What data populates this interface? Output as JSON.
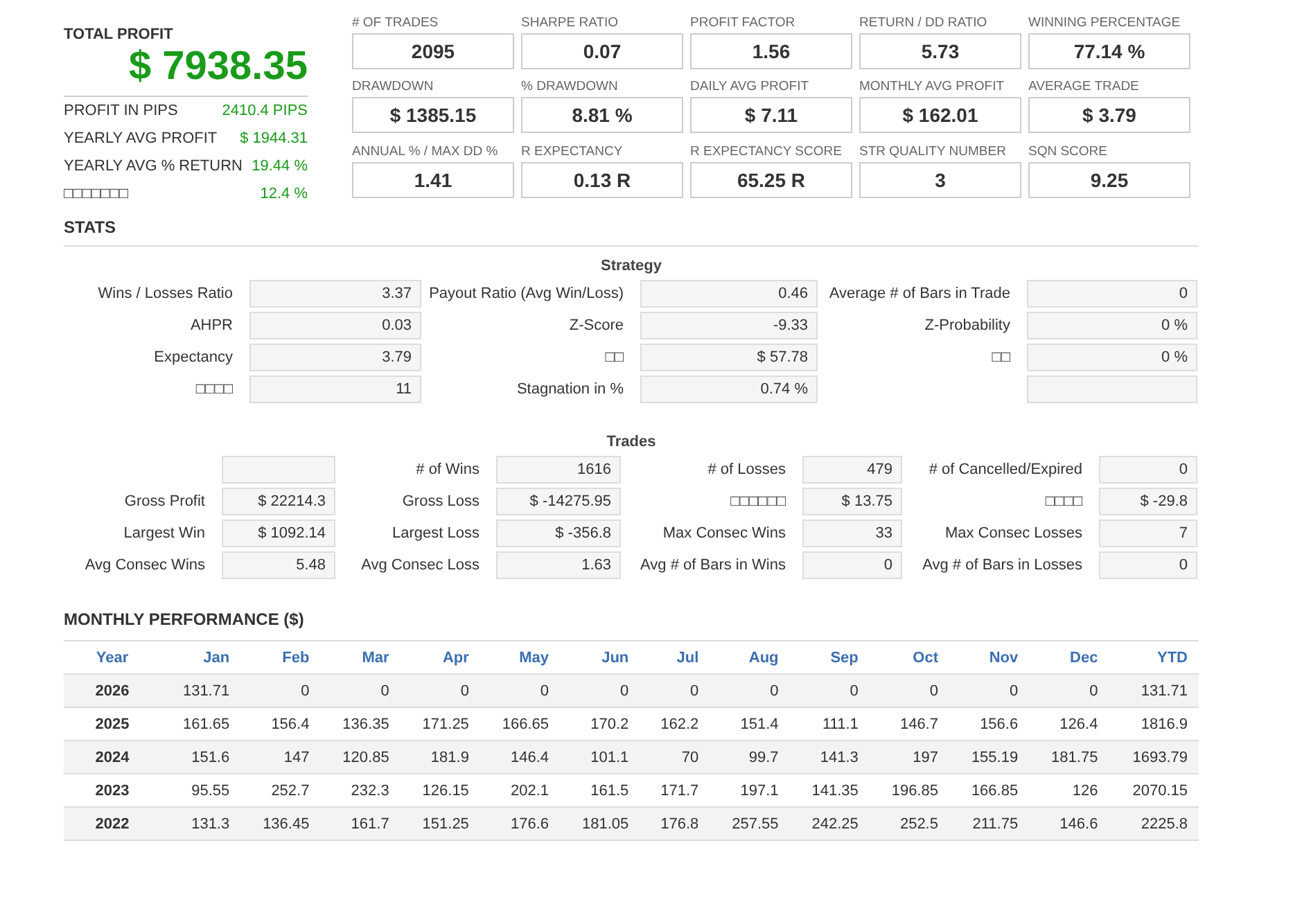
{
  "summary": {
    "title": "TOTAL PROFIT",
    "value": "$ 7938.35",
    "rows": [
      {
        "label": "PROFIT IN PIPS",
        "value": "2410.4 PIPS"
      },
      {
        "label": "YEARLY AVG PROFIT",
        "value": "$ 1944.31"
      },
      {
        "label": "YEARLY AVG % RETURN",
        "value": "19.44 %"
      },
      {
        "label": "□□□□□□□",
        "value": "12.4 %"
      }
    ]
  },
  "metrics": [
    {
      "label": "# OF TRADES",
      "value": "2095"
    },
    {
      "label": "SHARPE RATIO",
      "value": "0.07"
    },
    {
      "label": "PROFIT FACTOR",
      "value": "1.56"
    },
    {
      "label": "RETURN / DD RATIO",
      "value": "5.73"
    },
    {
      "label": "WINNING PERCENTAGE",
      "value": "77.14 %"
    },
    {
      "label": "DRAWDOWN",
      "value": "$ 1385.15"
    },
    {
      "label": "% DRAWDOWN",
      "value": "8.81 %"
    },
    {
      "label": "DAILY AVG PROFIT",
      "value": "$ 7.11"
    },
    {
      "label": "MONTHLY AVG PROFIT",
      "value": "$ 162.01"
    },
    {
      "label": "AVERAGE TRADE",
      "value": "$ 3.79"
    },
    {
      "label": "ANNUAL % / MAX DD %",
      "value": "1.41"
    },
    {
      "label": "R EXPECTANCY",
      "value": "0.13 R"
    },
    {
      "label": "R EXPECTANCY SCORE",
      "value": "65.25 R"
    },
    {
      "label": "STR QUALITY NUMBER",
      "value": "3"
    },
    {
      "label": "SQN SCORE",
      "value": "9.25"
    }
  ],
  "stats": {
    "heading": "STATS",
    "sections": [
      {
        "kind": "strategy",
        "title": "Strategy",
        "rows": [
          [
            {
              "label": "Wins / Losses Ratio",
              "value": "3.37"
            },
            {
              "label": "Payout Ratio (Avg Win/Loss)",
              "value": "0.46"
            },
            {
              "label": "Average # of Bars in Trade",
              "value": "0"
            }
          ],
          [
            {
              "label": "AHPR",
              "value": "0.03"
            },
            {
              "label": "Z-Score",
              "value": "-9.33"
            },
            {
              "label": "Z-Probability",
              "value": "0 %"
            }
          ],
          [
            {
              "label": "Expectancy",
              "value": "3.79"
            },
            {
              "label": "□□",
              "value": "$ 57.78"
            },
            {
              "label": "□□",
              "value": "0 %"
            }
          ],
          [
            {
              "label": "□□□□",
              "value": "11"
            },
            {
              "label": "Stagnation in %",
              "value": "0.74 %"
            },
            {}
          ]
        ]
      },
      {
        "kind": "trades",
        "title": "Trades",
        "rows": [
          [
            {},
            {
              "label": "# of Wins",
              "value": "1616"
            },
            {
              "label": "# of Losses",
              "value": "479"
            },
            {
              "label": "# of Cancelled/Expired",
              "value": "0"
            }
          ],
          [
            {
              "label": "Gross Profit",
              "value": "$ 22214.3"
            },
            {
              "label": "Gross Loss",
              "value": "$ -14275.95"
            },
            {
              "label": "□□□□□□",
              "value": "$ 13.75"
            },
            {
              "label": "□□□□",
              "value": "$ -29.8"
            }
          ],
          [
            {
              "label": "Largest Win",
              "value": "$ 1092.14"
            },
            {
              "label": "Largest Loss",
              "value": "$ -356.8"
            },
            {
              "label": "Max Consec Wins",
              "value": "33"
            },
            {
              "label": "Max Consec Losses",
              "value": "7"
            }
          ],
          [
            {
              "label": "Avg Consec Wins",
              "value": "5.48"
            },
            {
              "label": "Avg Consec Loss",
              "value": "1.63"
            },
            {
              "label": "Avg # of Bars in Wins",
              "value": "0"
            },
            {
              "label": "Avg # of Bars in Losses",
              "value": "0"
            }
          ]
        ]
      }
    ]
  },
  "monthly": {
    "title": "MONTHLY PERFORMANCE ($)",
    "columns": [
      "Year",
      "Jan",
      "Feb",
      "Mar",
      "Apr",
      "May",
      "Jun",
      "Jul",
      "Aug",
      "Sep",
      "Oct",
      "Nov",
      "Dec",
      "YTD"
    ],
    "rows": [
      [
        "2026",
        "131.71",
        "0",
        "0",
        "0",
        "0",
        "0",
        "0",
        "0",
        "0",
        "0",
        "0",
        "0",
        "131.71"
      ],
      [
        "2025",
        "161.65",
        "156.4",
        "136.35",
        "171.25",
        "166.65",
        "170.2",
        "162.2",
        "151.4",
        "111.1",
        "146.7",
        "156.6",
        "126.4",
        "1816.9"
      ],
      [
        "2024",
        "151.6",
        "147",
        "120.85",
        "181.9",
        "146.4",
        "101.1",
        "70",
        "99.7",
        "141.3",
        "197",
        "155.19",
        "181.75",
        "1693.79"
      ],
      [
        "2023",
        "95.55",
        "252.7",
        "232.3",
        "126.15",
        "202.1",
        "161.5",
        "171.7",
        "197.1",
        "141.35",
        "196.85",
        "166.85",
        "126",
        "2070.15"
      ],
      [
        "2022",
        "131.3",
        "136.45",
        "161.7",
        "151.25",
        "176.6",
        "181.05",
        "176.8",
        "257.55",
        "242.25",
        "252.5",
        "211.75",
        "146.6",
        "2225.8"
      ]
    ]
  }
}
